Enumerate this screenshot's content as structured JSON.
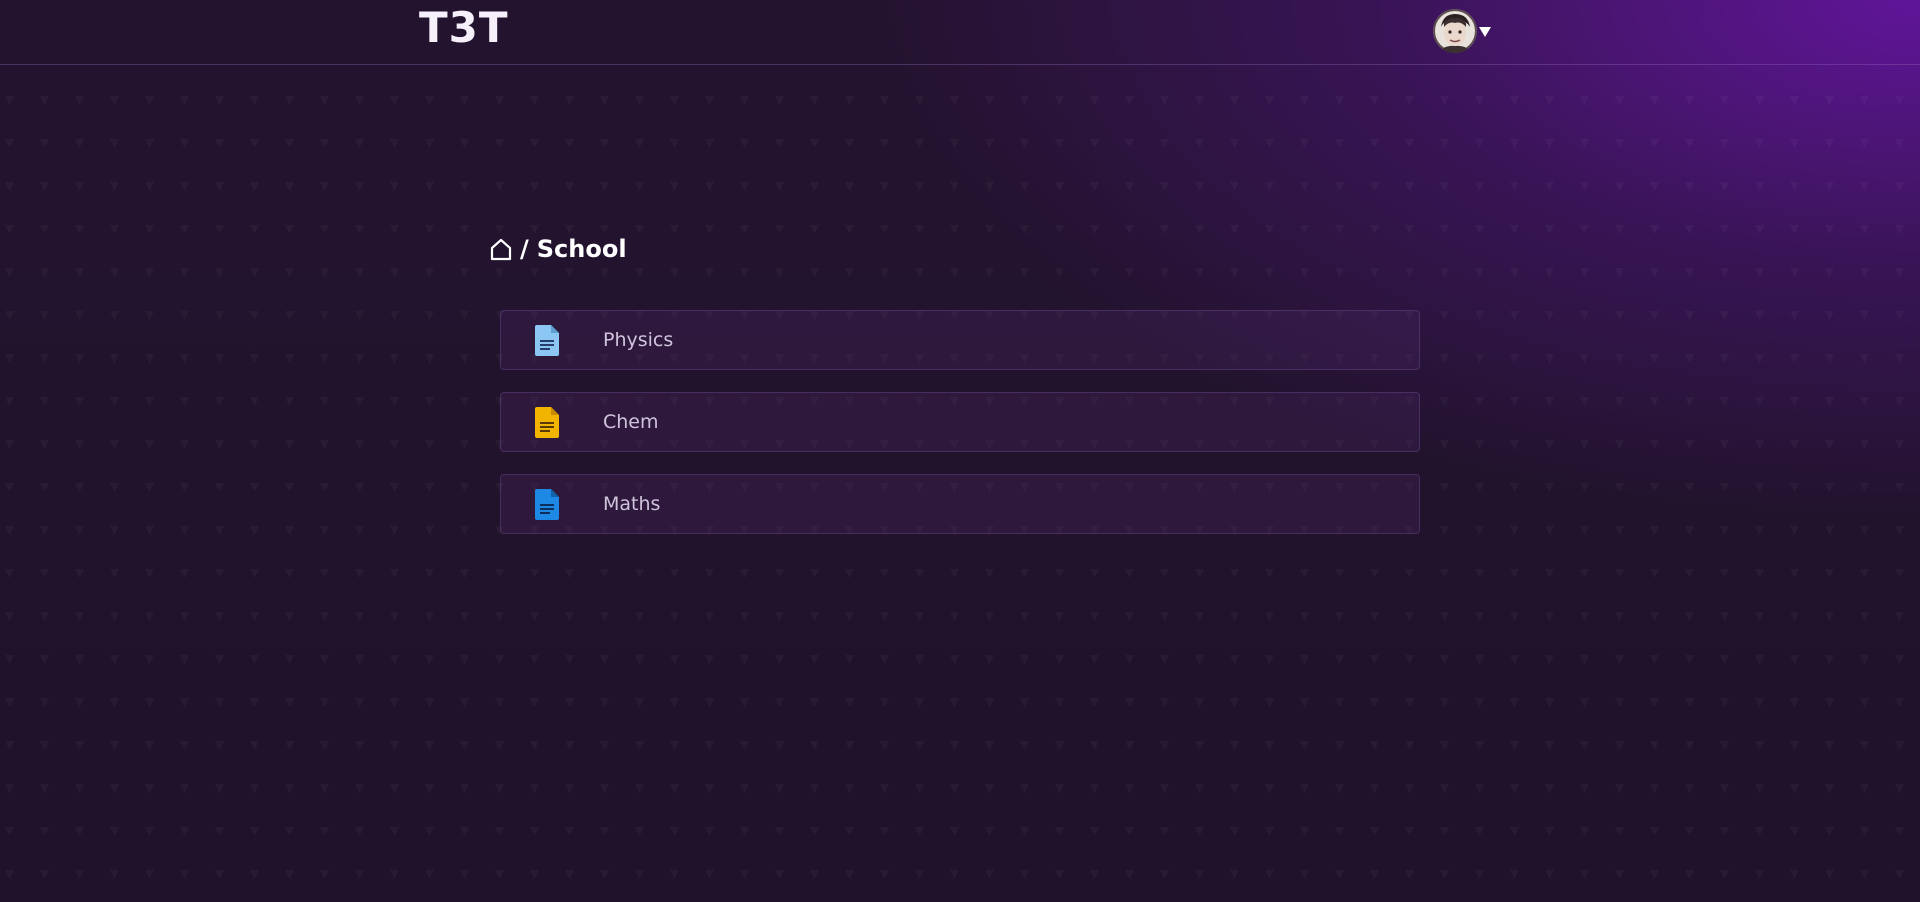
{
  "app": {
    "logo": "T3T"
  },
  "user_menu": {
    "avatar_icon": "user-avatar",
    "caret_icon": "caret-down-icon"
  },
  "breadcrumb": {
    "home_icon": "home-icon",
    "separator": "/",
    "current": "School"
  },
  "files": [
    {
      "name": "Physics",
      "icon": "document-icon",
      "color": "#8bc7f2"
    },
    {
      "name": "Chem",
      "icon": "document-icon",
      "color": "#f3b400"
    },
    {
      "name": "Maths",
      "icon": "document-icon",
      "color": "#1e88e5"
    }
  ],
  "theme": {
    "background": "#201229",
    "accent": "#6a14b4",
    "text": "#ffffff"
  }
}
